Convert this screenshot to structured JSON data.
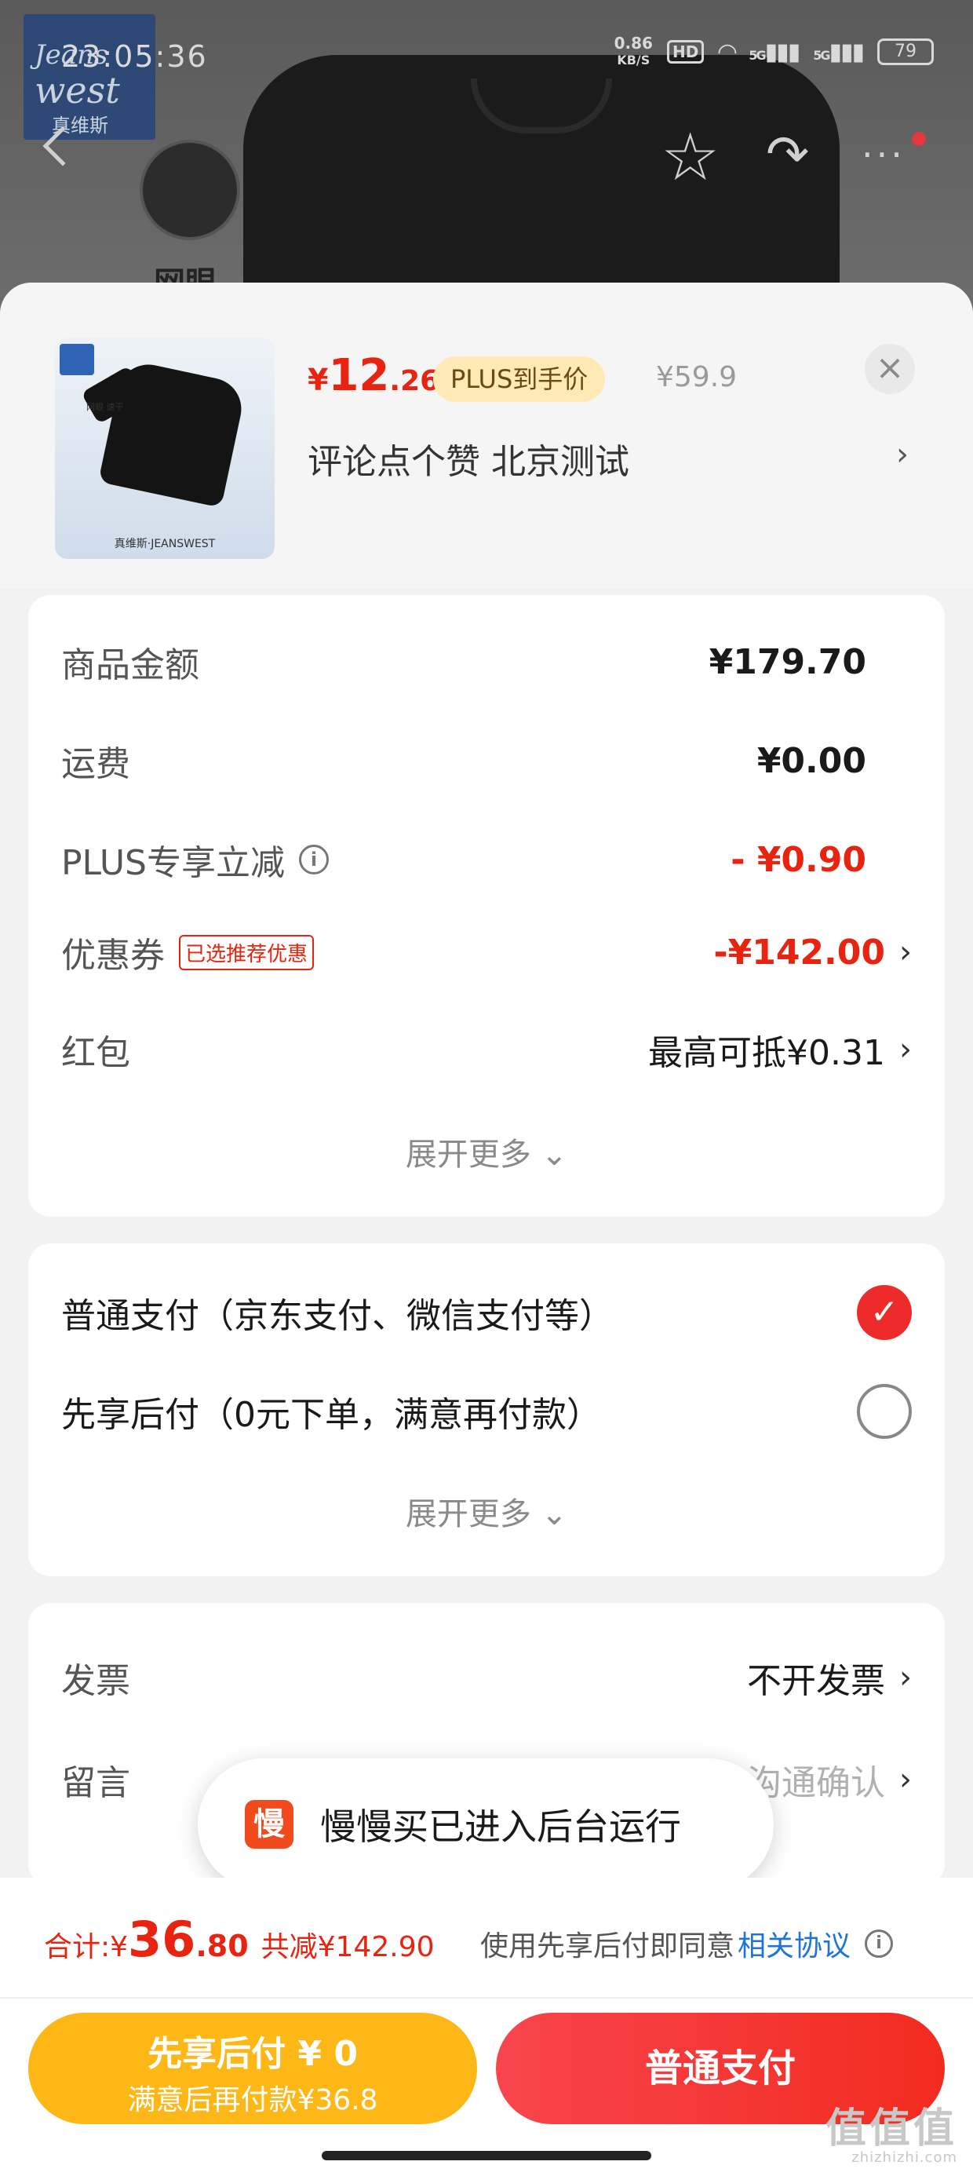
{
  "status_bar": {
    "time": "23:05:36",
    "net_speed": "0.86",
    "net_unit": "KB/S",
    "hd": "HD",
    "sig1": "5G",
    "sig2": "5G",
    "battery": "79"
  },
  "background": {
    "brand_line1": "Jeans",
    "brand_line2": "west",
    "brand_cn": "真维斯",
    "badge_text": "网眼"
  },
  "product": {
    "price_yen": "¥",
    "price_int": "12",
    "price_dec": ".26",
    "plus_badge": "PLUS到手价",
    "original_price": "¥59.9",
    "title": "评论点个赞  北京测试",
    "thumb_caption": "真维斯·JEANSWEST",
    "thumb_mini": "网眼 速干"
  },
  "price_card": {
    "rows": [
      {
        "label": "商品金额",
        "value": "¥179.70"
      },
      {
        "label": "运费",
        "value": "¥0.00"
      },
      {
        "label": "PLUS专享立减",
        "value": "- ¥0.90"
      },
      {
        "label": "优惠券",
        "tag": "已选推荐优惠",
        "value": "-¥142.00"
      },
      {
        "label": "红包",
        "value": "最高可抵¥0.31"
      }
    ],
    "expand": "展开更多 ⌄"
  },
  "pay_card": {
    "option1": "普通支付（京东支付、微信支付等）",
    "option2": "先享后付（0元下单，满意再付款）",
    "expand": "展开更多 ⌄"
  },
  "invoice_card": {
    "invoice_label": "发票",
    "invoice_value": "不开发票",
    "note_label": "留言",
    "note_value": "沟通确认"
  },
  "toast": {
    "icon_char": "慢",
    "text": "慢慢买已进入后台运行"
  },
  "footer": {
    "sum_label": "合计: ",
    "sum_yen": "¥",
    "sum_int": "36",
    "sum_dec": ".80",
    "discount": "共减¥142.90",
    "agree_text": "使用先享后付即同意",
    "agree_link": "相关协议",
    "btn_later_line1": "先享后付 ¥ 0",
    "btn_later_line2": "满意后再付款¥36.8",
    "btn_normal": "普通支付"
  },
  "watermark": {
    "main": "值值值",
    "sub": "zhizhizhi.com"
  },
  "colors": {
    "accent_red": "#e8230f",
    "button_yellow": "#fdb716",
    "link_blue": "#1f74d6"
  }
}
